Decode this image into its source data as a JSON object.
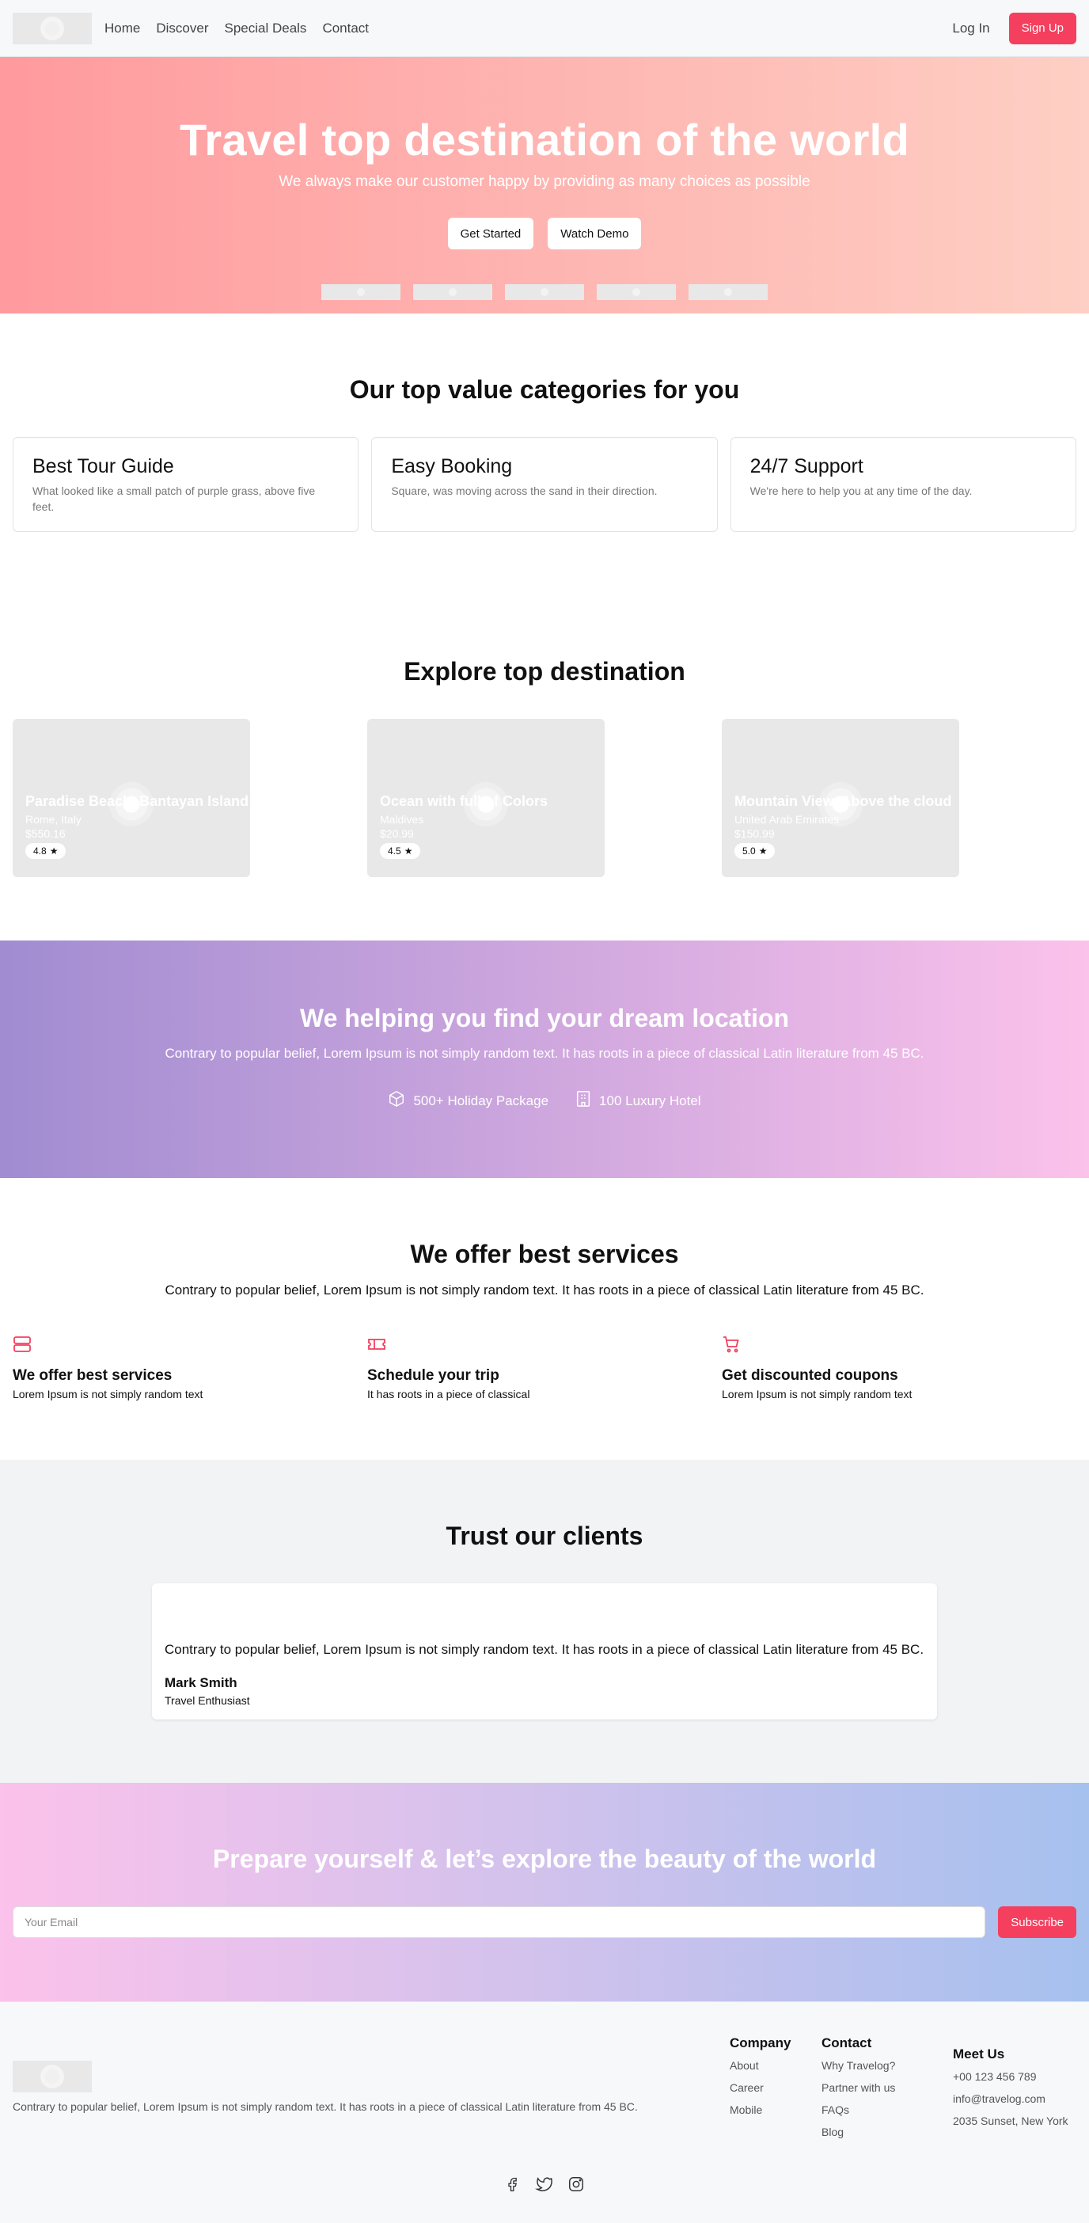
{
  "nav": {
    "links": [
      "Home",
      "Discover",
      "Special Deals",
      "Contact"
    ],
    "login": "Log In",
    "signup": "Sign Up"
  },
  "hero": {
    "title": "Travel top destination of the world",
    "subtitle": "We always make our customer happy by providing as many choices as possible",
    "cta_primary": "Get Started",
    "cta_secondary": "Watch Demo"
  },
  "categories": {
    "title": "Our top value categories for you",
    "items": [
      {
        "title": "Best Tour Guide",
        "desc": "What looked like a small patch of purple grass, above five feet."
      },
      {
        "title": "Easy Booking",
        "desc": "Square, was moving across the sand in their direction."
      },
      {
        "title": "24/7 Support",
        "desc": "We're here to help you at any time of the day."
      }
    ]
  },
  "destinations": {
    "title": "Explore top destination",
    "items": [
      {
        "name": "Paradise Beach, Bantayan Island",
        "location": "Rome, Italy",
        "price": "$550.16",
        "rating": "4.8"
      },
      {
        "name": "Ocean with full of Colors",
        "location": "Maldives",
        "price": "$20.99",
        "rating": "4.5"
      },
      {
        "name": "Mountain View, Above the cloud",
        "location": "United Arab Emirates",
        "price": "$150.99",
        "rating": "5.0"
      }
    ]
  },
  "dream": {
    "title": "We helping you find your dream location",
    "subtitle": "Contrary to popular belief, Lorem Ipsum is not simply random text. It has roots in a piece of classical Latin literature from 45 BC.",
    "stat1": "500+ Holiday Package",
    "stat2": "100 Luxury Hotel"
  },
  "services": {
    "title": "We offer best services",
    "subtitle": "Contrary to popular belief, Lorem Ipsum is not simply random text. It has roots in a piece of classical Latin literature from 45 BC.",
    "items": [
      {
        "title": "We offer best services",
        "desc": "Lorem Ipsum is not simply random text",
        "icon": "server-icon"
      },
      {
        "title": "Schedule your trip",
        "desc": "It has roots in a piece of classical",
        "icon": "ticket-icon"
      },
      {
        "title": "Get discounted coupons",
        "desc": "Lorem Ipsum is not simply random text",
        "icon": "cart-icon"
      }
    ]
  },
  "trust": {
    "title": "Trust our clients",
    "quote": "Contrary to popular belief, Lorem Ipsum is not simply random text. It has roots in a piece of classical Latin literature from 45 BC.",
    "author": "Mark Smith",
    "role": "Travel Enthusiast"
  },
  "subscribe": {
    "title": "Prepare yourself & let’s explore the beauty of the world",
    "placeholder": "Your Email",
    "button": "Subscribe"
  },
  "footer": {
    "about": "Contrary to popular belief, Lorem Ipsum is not simply random text. It has roots in a piece of classical Latin literature from 45 BC.",
    "company": {
      "title": "Company",
      "links": [
        "About",
        "Career",
        "Mobile"
      ]
    },
    "contact": {
      "title": "Contact",
      "links": [
        "Why Travelog?",
        "Partner with us",
        "FAQs",
        "Blog"
      ]
    },
    "meet": {
      "title": "Meet Us",
      "lines": [
        "+00 123 456 789",
        "info@travelog.com",
        "2035 Sunset, New York"
      ]
    }
  },
  "colors": {
    "accent": "#f43f5e",
    "hero_from": "#ff9a9e",
    "hero_to": "#fecfc4",
    "dream_from": "#a18cd1",
    "dream_to": "#fbc2eb",
    "sub_to": "#a6c1ee"
  }
}
